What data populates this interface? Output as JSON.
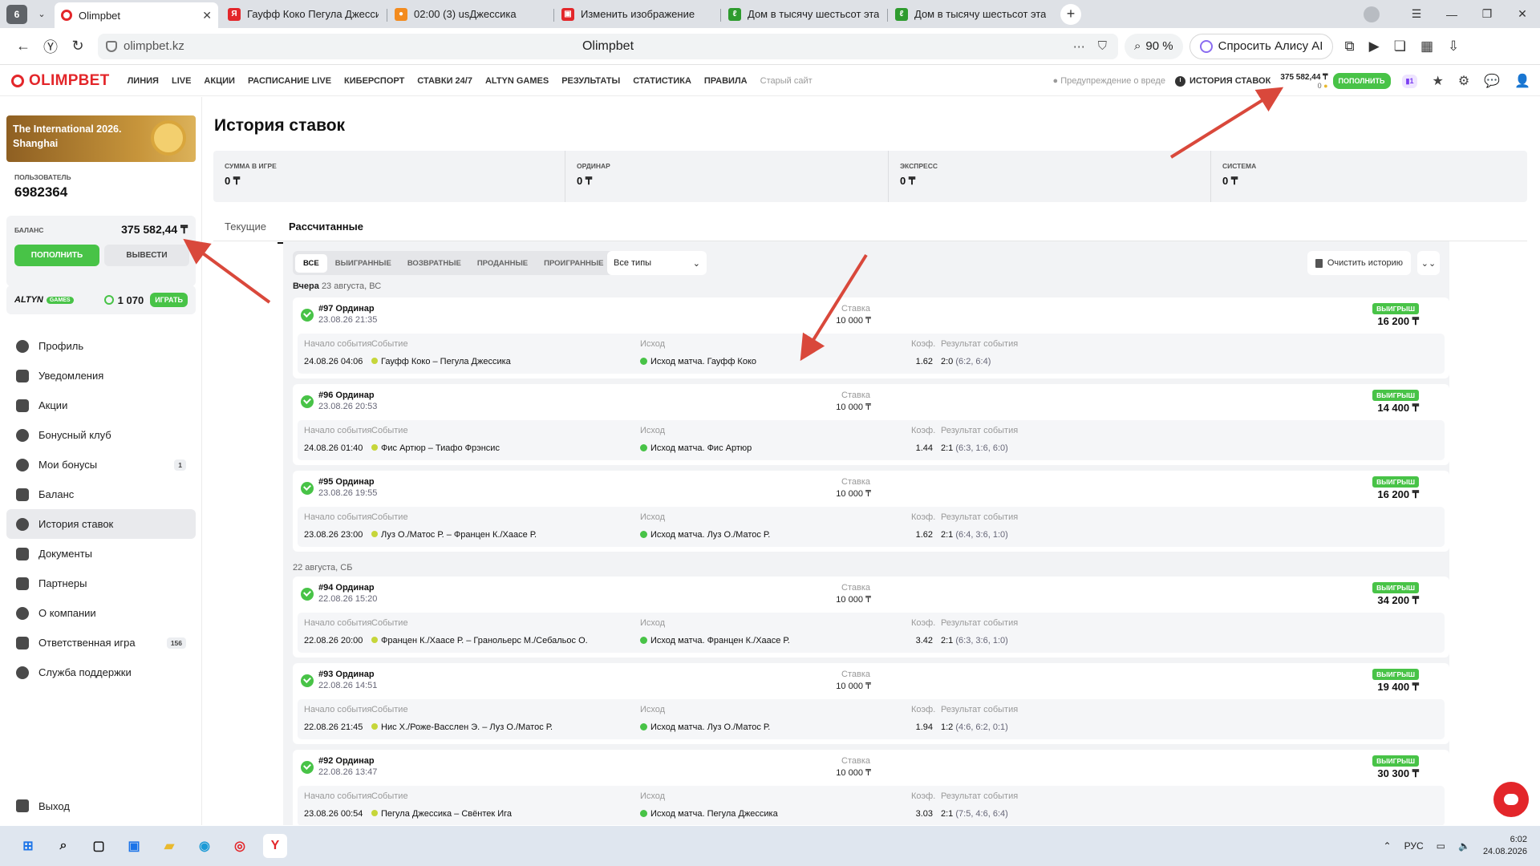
{
  "browser": {
    "tab_count": "6",
    "tabs": [
      {
        "title": "Olimpbet",
        "color": "#e3262a"
      },
      {
        "title": "Гауфф Коко Пегула Джессика",
        "color": "#e3262a"
      },
      {
        "title": "02:00 (3) usДжессика",
        "color": "#f38b1e"
      },
      {
        "title": "Изменить изображение",
        "color": "#e3262a"
      },
      {
        "title": "Дом в тысячу шестьсот этажей",
        "color": "#2e9b2e"
      },
      {
        "title": "Дом в тысячу шестьсот этажей",
        "color": "#2e9b2e"
      }
    ],
    "url": "olimpbet.kz",
    "page_title": "Olimpbet",
    "zoom": "90 %",
    "alice": "Спросить Алису AI"
  },
  "header": {
    "logo": "OLIMPBET",
    "nav": [
      "ЛИНИЯ",
      "LIVE",
      "АКЦИИ",
      "РАСПИСАНИЕ LIVE",
      "КИБЕРСПОРТ",
      "СТАВКИ 24/7",
      "ALTYN GAMES",
      "РЕЗУЛЬТАТЫ",
      "СТАТИСТИКА",
      "ПРАВИЛА"
    ],
    "old_site": "Старый сайт",
    "warning": "Предупреждение о вреде",
    "history": "ИСТОРИЯ СТАВОК",
    "balance": "375 582,44 ₸",
    "bonus": "0",
    "topup": "ПОПОЛНИТЬ",
    "promo_count": "1"
  },
  "sidebar": {
    "banner": "The International 2026. Shanghai",
    "user_label": "ПОЛЬЗОВАТЕЛЬ",
    "user_id": "6982364",
    "balance_label": "БАЛАНС",
    "balance": "375 582,44 ₸",
    "topup": "ПОПОЛНИТЬ",
    "withdraw": "ВЫВЕСТИ",
    "altyn_brand": "ALTYN",
    "altyn_games": "GAMES",
    "altyn_amount": "1 070",
    "altyn_play": "ИГРАТЬ",
    "menu": [
      {
        "label": "Профиль",
        "count": ""
      },
      {
        "label": "Уведомления",
        "count": ""
      },
      {
        "label": "Акции",
        "count": ""
      },
      {
        "label": "Бонусный клуб",
        "count": ""
      },
      {
        "label": "Мои бонусы",
        "count": "1"
      },
      {
        "label": "Баланс",
        "count": ""
      },
      {
        "label": "История ставок",
        "count": ""
      },
      {
        "label": "Документы",
        "count": ""
      },
      {
        "label": "Партнеры",
        "count": ""
      },
      {
        "label": "О компании",
        "count": ""
      },
      {
        "label": "Ответственная игра",
        "count": "156"
      },
      {
        "label": "Служба поддержки",
        "count": ""
      }
    ],
    "logout": "Выход"
  },
  "main": {
    "title": "История ставок",
    "stats": [
      {
        "label": "СУММА В ИГРЕ",
        "value": "0 ₸"
      },
      {
        "label": "ОРДИНАР",
        "value": "0 ₸"
      },
      {
        "label": "ЭКСПРЕСС",
        "value": "0 ₸"
      },
      {
        "label": "СИСТЕМА",
        "value": "0 ₸"
      }
    ],
    "tabs": [
      "Текущие",
      "Рассчитанные"
    ],
    "filters": [
      "ВСЕ",
      "ВЫИГРАННЫЕ",
      "ВОЗВРАТНЫЕ",
      "ПРОДАННЫЕ",
      "ПРОИГРАННЫЕ"
    ],
    "type_select": "Все типы",
    "clear": "Очистить историю",
    "date1_bold": "Вчера",
    "date1": "23 августа, ВС",
    "date2": "22 августа, СБ",
    "col_start": "Начало события",
    "col_event": "Событие",
    "col_outcome": "Исход",
    "col_coef": "Коэф.",
    "col_result": "Результат события",
    "stake_label": "Ставка",
    "win_label": "ВЫИГРЫШ",
    "bets": [
      {
        "id": "#97 Ординар",
        "placed": "23.08.26 21:35",
        "stake": "10 000 ₸",
        "win": "16 200 ₸",
        "start": "24.08.26 04:06",
        "event": "Гауфф Коко – Пегула Джессика",
        "outcome": "Исход матча. Гауфф Коко",
        "coef": "1.62",
        "score": "2:0",
        "sets": "(6:2, 6:4)"
      },
      {
        "id": "#96 Ординар",
        "placed": "23.08.26 20:53",
        "stake": "10 000 ₸",
        "win": "14 400 ₸",
        "start": "24.08.26 01:40",
        "event": "Фис Артюр – Тиафо Фрэнсис",
        "outcome": "Исход матча. Фис Артюр",
        "coef": "1.44",
        "score": "2:1",
        "sets": "(6:3, 1:6, 6:0)"
      },
      {
        "id": "#95 Ординар",
        "placed": "23.08.26 19:55",
        "stake": "10 000 ₸",
        "win": "16 200 ₸",
        "start": "23.08.26 23:00",
        "event": "Луз О./Матос Р. – Францен К./Хаасе Р.",
        "outcome": "Исход матча. Луз О./Матос Р.",
        "coef": "1.62",
        "score": "2:1",
        "sets": "(6:4, 3:6, 1:0)"
      },
      {
        "id": "#94 Ординар",
        "placed": "22.08.26 15:20",
        "stake": "10 000 ₸",
        "win": "34 200 ₸",
        "start": "22.08.26 20:00",
        "event": "Францен К./Хаасе Р. – Гранольерс М./Себальос О.",
        "outcome": "Исход матча. Францен К./Хаасе Р.",
        "coef": "3.42",
        "score": "2:1",
        "sets": "(6:3, 3:6, 1:0)"
      },
      {
        "id": "#93 Ординар",
        "placed": "22.08.26 14:51",
        "stake": "10 000 ₸",
        "win": "19 400 ₸",
        "start": "22.08.26 21:45",
        "event": "Нис Х./Роже-Васслен Э. – Луз О./Матос Р.",
        "outcome": "Исход матча. Луз О./Матос Р.",
        "coef": "1.94",
        "score": "1:2",
        "sets": "(4:6, 6:2, 0:1)"
      },
      {
        "id": "#92 Ординар",
        "placed": "22.08.26 13:47",
        "stake": "10 000 ₸",
        "win": "30 300 ₸",
        "start": "23.08.26 00:54",
        "event": "Пегула Джессика – Свёнтек Ига",
        "outcome": "Исход матча. Пегула Джессика",
        "coef": "3.03",
        "score": "2:1",
        "sets": "(7:5, 4:6, 6:4)"
      }
    ]
  },
  "taskbar": {
    "lang": "РУС",
    "time": "6:02",
    "date": "24.08.2026"
  },
  "colors": {
    "brand": "#e3262a",
    "accent_green": "#48c347"
  }
}
